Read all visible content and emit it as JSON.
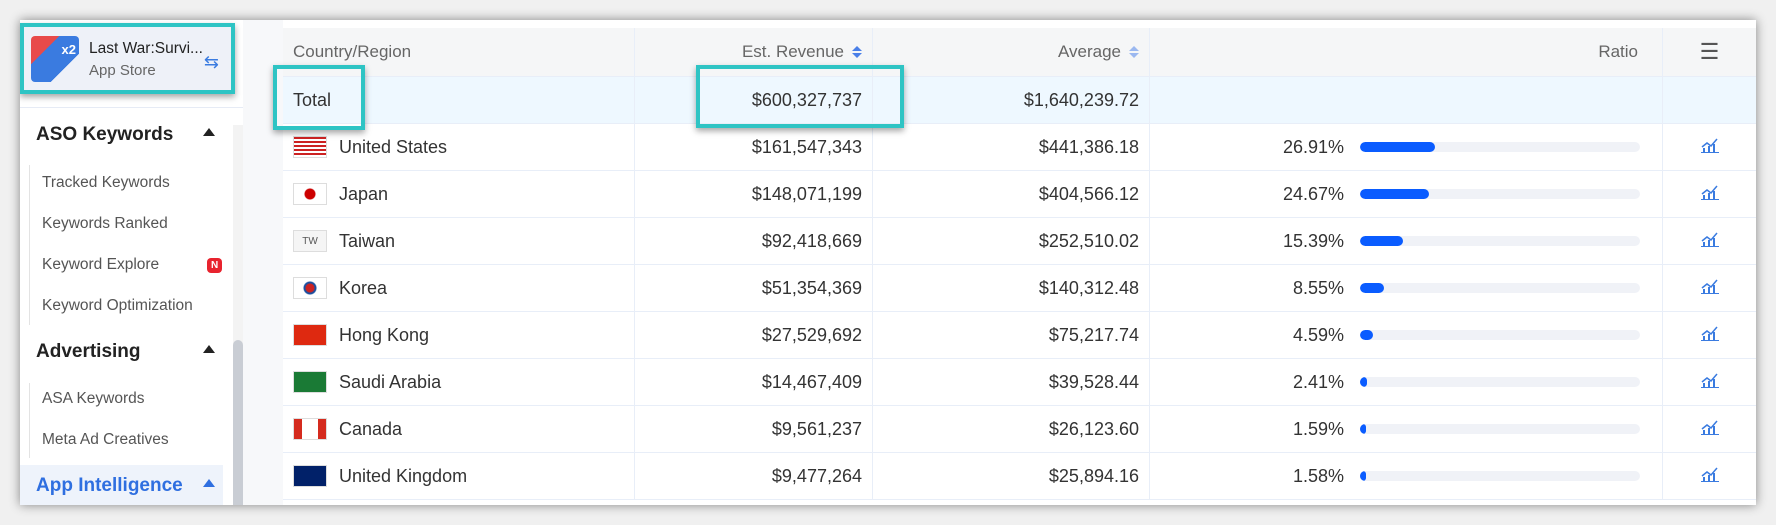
{
  "app": {
    "name": "Last War:Survi...",
    "store": "App Store",
    "icon_text": "x2",
    "switch_icon": "swap-icon"
  },
  "sidebar": {
    "sections": [
      {
        "title": "ASO Keywords",
        "items": [
          {
            "label": "Tracked Keywords"
          },
          {
            "label": "Keywords Ranked"
          },
          {
            "label": "Keyword Explore",
            "badge": "N"
          },
          {
            "label": "Keyword Optimization"
          }
        ]
      },
      {
        "title": "Advertising",
        "items": [
          {
            "label": "ASA Keywords"
          },
          {
            "label": "Meta Ad Creatives"
          }
        ]
      },
      {
        "title": "App Intelligence",
        "active": true
      }
    ]
  },
  "table": {
    "headers": {
      "country": "Country/Region",
      "revenue": "Est. Revenue",
      "average": "Average",
      "ratio": "Ratio"
    },
    "total": {
      "label": "Total",
      "revenue": "$600,327,737",
      "average": "$1,640,239.72"
    },
    "rows": [
      {
        "flag": "us",
        "country": "United States",
        "revenue": "$161,547,343",
        "average": "$441,386.18",
        "ratio": "26.91%",
        "pct": 26.91
      },
      {
        "flag": "jp",
        "country": "Japan",
        "revenue": "$148,071,199",
        "average": "$404,566.12",
        "ratio": "24.67%",
        "pct": 24.67
      },
      {
        "flag": "tw",
        "flag_text": "TW",
        "country": "Taiwan",
        "revenue": "$92,418,669",
        "average": "$252,510.02",
        "ratio": "15.39%",
        "pct": 15.39
      },
      {
        "flag": "kr",
        "country": "Korea",
        "revenue": "$51,354,369",
        "average": "$140,312.48",
        "ratio": "8.55%",
        "pct": 8.55
      },
      {
        "flag": "hk",
        "country": "Hong Kong",
        "revenue": "$27,529,692",
        "average": "$75,217.74",
        "ratio": "4.59%",
        "pct": 4.59
      },
      {
        "flag": "sa",
        "country": "Saudi Arabia",
        "revenue": "$14,467,409",
        "average": "$39,528.44",
        "ratio": "2.41%",
        "pct": 2.41
      },
      {
        "flag": "ca",
        "country": "Canada",
        "revenue": "$9,561,237",
        "average": "$26,123.60",
        "ratio": "1.59%",
        "pct": 1.59
      },
      {
        "flag": "gb",
        "country": "United Kingdom",
        "revenue": "$9,477,264",
        "average": "$25,894.16",
        "ratio": "1.58%",
        "pct": 1.58
      }
    ]
  },
  "colors": {
    "highlight": "#2ec4c4",
    "bar": "#0a5cff",
    "accent": "#3a7be0"
  }
}
